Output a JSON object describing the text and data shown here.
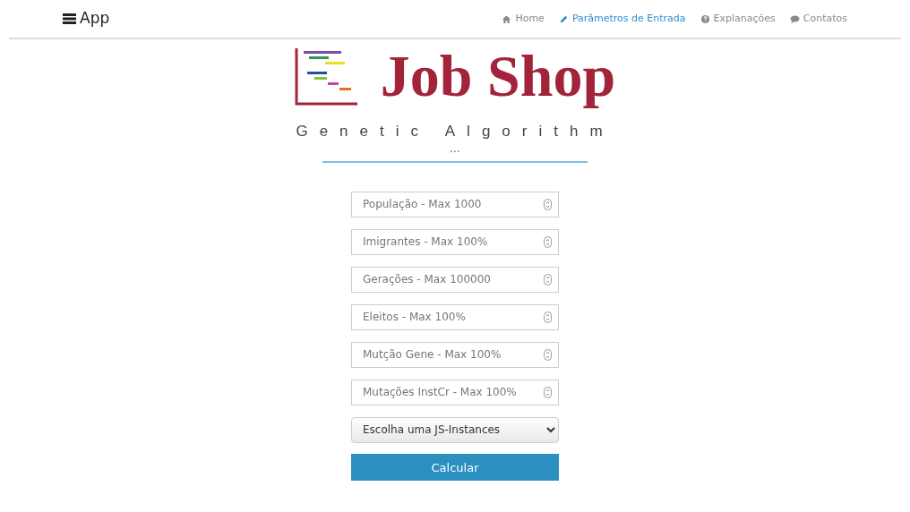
{
  "navbar": {
    "brand": "App",
    "items": [
      {
        "label": "Home",
        "kind": "home",
        "selected": false
      },
      {
        "label": "Parâmetros de Entrada",
        "kind": "edit",
        "selected": true
      },
      {
        "label": "Explanações",
        "kind": "help",
        "selected": false
      },
      {
        "label": "Contatos",
        "kind": "contact",
        "selected": false
      }
    ]
  },
  "header": {
    "title": "Job Shop",
    "subtitle": "Genetic Algorithm",
    "ellipsis": "..."
  },
  "form": {
    "fields": [
      {
        "placeholder": "População - Max 1000"
      },
      {
        "placeholder": "Imigrantes - Max 100%"
      },
      {
        "placeholder": "Gerações - Max 100000"
      },
      {
        "placeholder": "Eleitos - Max 100%"
      },
      {
        "placeholder": "Mutção Gene - Max 100%"
      },
      {
        "placeholder": "Mutações InstCr - Max 100%"
      }
    ],
    "select": {
      "value": "Escolha uma JS-Instances"
    },
    "button": "Calcular"
  }
}
